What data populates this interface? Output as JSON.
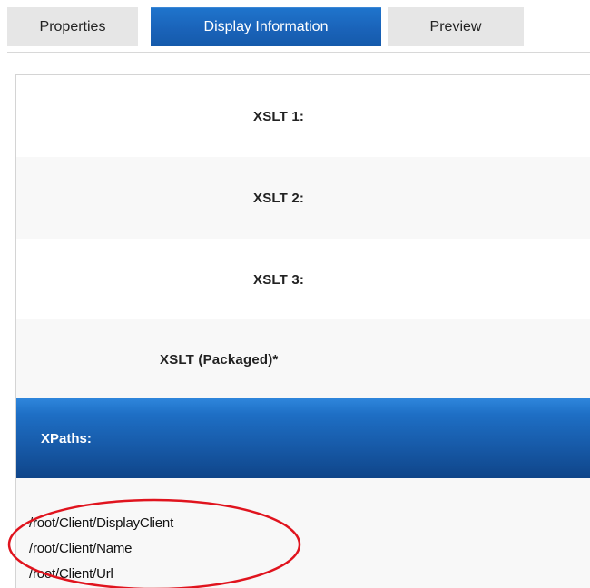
{
  "tabs": [
    {
      "label": "Properties",
      "active": false
    },
    {
      "label": "Display Information",
      "active": true
    },
    {
      "label": "Preview",
      "active": false
    }
  ],
  "rows": [
    {
      "label": "XSLT 1:"
    },
    {
      "label": "XSLT 2:"
    },
    {
      "label": "XSLT 3:"
    },
    {
      "label": "XSLT (Packaged)*"
    }
  ],
  "xpaths": {
    "header": "XPaths:",
    "items": [
      "/root/Client/DisplayClient",
      "/root/Client/Name",
      "/root/Client/Url"
    ]
  },
  "colors": {
    "active_tab": "#1a63b9",
    "header_blue": "#175aa8",
    "annotation": "#e0141e"
  }
}
